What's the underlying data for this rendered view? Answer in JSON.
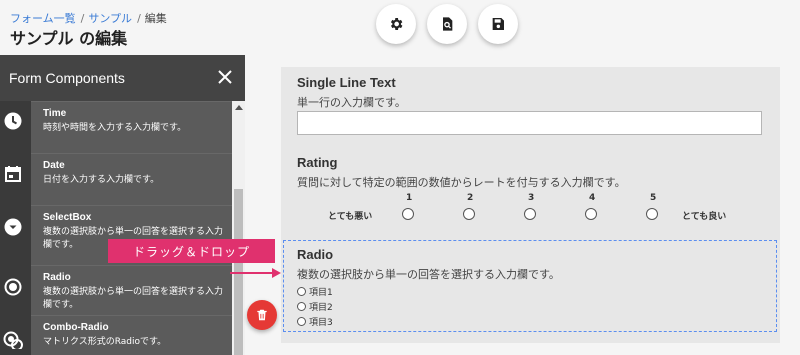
{
  "breadcrumb": {
    "items": [
      "フォーム一覧",
      "サンプル",
      "編集"
    ],
    "separator": "/"
  },
  "page": {
    "title": "サンプル の編集"
  },
  "toolbar": {
    "buttons": [
      {
        "icon": "gear-icon"
      },
      {
        "icon": "preview-icon"
      },
      {
        "icon": "save-icon"
      }
    ]
  },
  "sidebar": {
    "title": "Form Components",
    "close_icon": "close-icon",
    "items": [
      {
        "name": "Time",
        "desc": "時刻や時間を入力する入力欄です。",
        "icon": "clock-icon"
      },
      {
        "name": "Date",
        "desc": "日付を入力する入力欄です。",
        "icon": "calendar-icon"
      },
      {
        "name": "SelectBox",
        "desc": "複数の選択肢から単一の回答を選択する入力欄です。",
        "icon": "dropdown-icon"
      },
      {
        "name": "Radio",
        "desc": "複数の選択肢から単一の回答を選択する入力欄です。",
        "icon": "radio-icon"
      },
      {
        "name": "Combo-Radio",
        "desc": "マトリクス形式のRadioです。",
        "icon": "combo-radio-icon"
      }
    ]
  },
  "drag_hint": "ドラッグ＆ドロップ",
  "form": {
    "single_line": {
      "title": "Single Line Text",
      "desc": "単一行の入力欄です。",
      "value": ""
    },
    "rating": {
      "title": "Rating",
      "desc": "質問に対して特定の範囲の数値からレートを付与する入力欄です。",
      "low_label": "とても悪い",
      "high_label": "とても良い",
      "scale": [
        "1",
        "2",
        "3",
        "4",
        "5"
      ]
    },
    "radio": {
      "title": "Radio",
      "desc": "複数の選択肢から単一の回答を選択する入力欄です。",
      "options": [
        "項目1",
        "項目2",
        "項目3"
      ]
    }
  },
  "colors": {
    "accent": "#e0316e",
    "link": "#3a7bd5",
    "danger": "#e53935",
    "sidebar_bg": "#3a3a3a",
    "drop_outline": "#5b8ef0"
  }
}
